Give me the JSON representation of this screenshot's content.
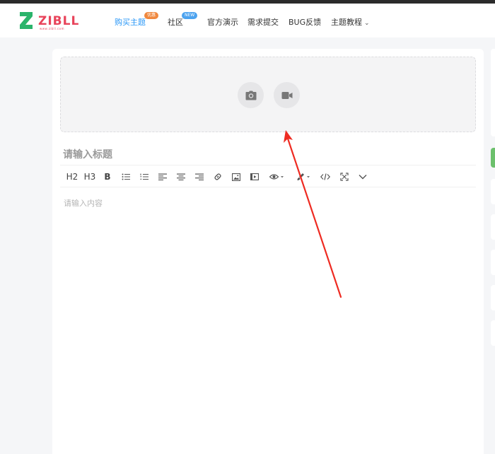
{
  "header": {
    "logo_text": "ZIBLL",
    "logo_sub": "www.zibll.com",
    "nav": [
      {
        "label": "购买主题",
        "badge": "优惠",
        "badge_color": "#f0883e",
        "active": true
      },
      {
        "label": "社区",
        "badge": "NEW",
        "badge_color": "#4da3ef"
      },
      {
        "label": "官方演示"
      },
      {
        "label": "需求提交"
      },
      {
        "label": "BUG反馈"
      },
      {
        "label": "主题教程",
        "dropdown": true
      }
    ]
  },
  "editor": {
    "upload": {
      "image_icon": "camera-icon",
      "video_icon": "video-camera-icon"
    },
    "title_placeholder": "请输入标题",
    "content_placeholder": "请输入内容",
    "toolbar": {
      "h2": "H2",
      "h3": "H3",
      "bold": "B",
      "icons": [
        "bullet-list-icon",
        "numbered-list-icon",
        "align-left-icon",
        "align-center-icon",
        "align-right-icon",
        "link-icon",
        "image-icon",
        "video-icon",
        "eye-icon",
        "paint-brush-icon",
        "code-icon",
        "fullscreen-icon",
        "chevron-down-icon"
      ]
    }
  },
  "colors": {
    "accent": "#2997f7",
    "brand": "#e8435a",
    "logo_green": "#2ab46b",
    "annotation_arrow": "#ee2b22"
  }
}
